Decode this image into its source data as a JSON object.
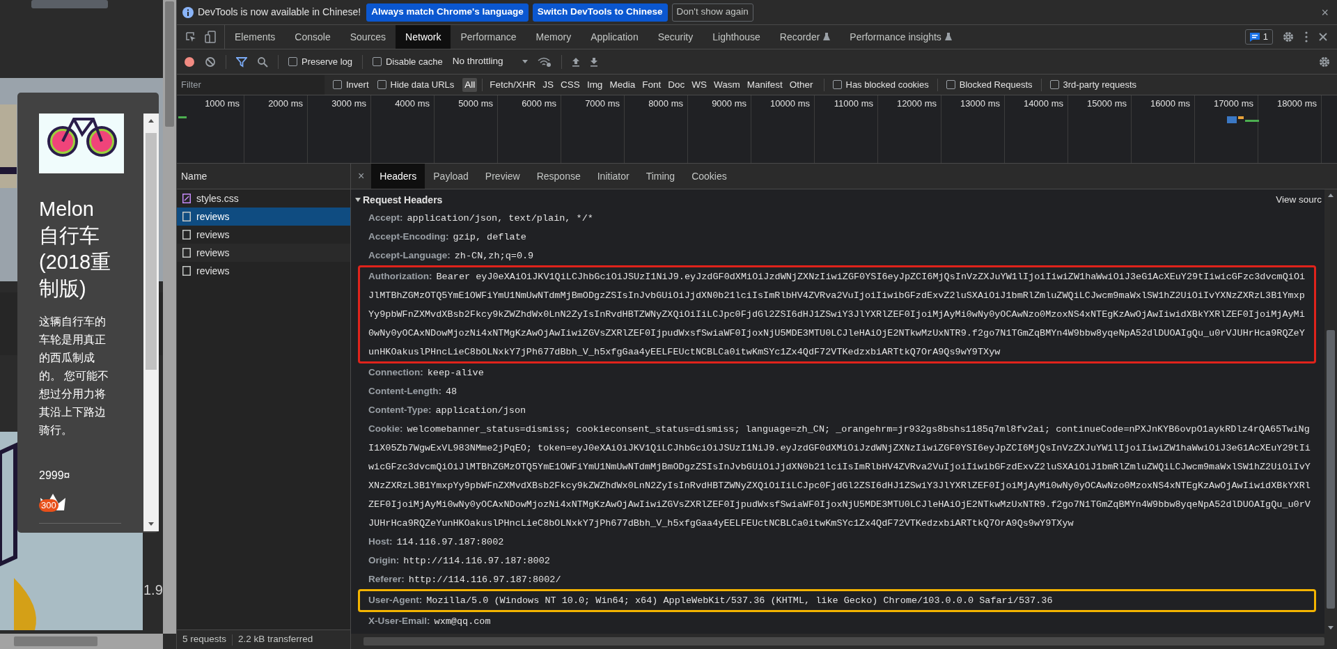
{
  "page": {
    "product_card": {
      "title": "Melon 自行车(2018重制版)",
      "description": "这辆自行车的车轮是用真正的西瓜制成的。 您可能不想过分用力将其沿上下路边骑行。",
      "price": "2999¤",
      "badge": "300"
    },
    "fragment": "1.9"
  },
  "devtools": {
    "infobar": {
      "message": "DevTools is now available in Chinese!",
      "buttons": [
        {
          "label": "Always match Chrome's language",
          "kind": "primary"
        },
        {
          "label": "Switch DevTools to Chinese",
          "kind": "primary"
        },
        {
          "label": "Don't show again",
          "kind": "secondary"
        }
      ],
      "close": "×"
    },
    "tabs": [
      {
        "label": "Elements",
        "selected": false,
        "kind": "plain"
      },
      {
        "label": "Console",
        "selected": false,
        "kind": "plain"
      },
      {
        "label": "Sources",
        "selected": false,
        "kind": "plain"
      },
      {
        "label": "Network",
        "selected": true,
        "kind": "plain"
      },
      {
        "label": "Performance",
        "selected": false,
        "kind": "plain"
      },
      {
        "label": "Memory",
        "selected": false,
        "kind": "plain"
      },
      {
        "label": "Application",
        "selected": false,
        "kind": "plain"
      },
      {
        "label": "Security",
        "selected": false,
        "kind": "plain"
      },
      {
        "label": "Lighthouse",
        "selected": false,
        "kind": "plain"
      },
      {
        "label": "Recorder",
        "selected": false,
        "kind": "experimental"
      },
      {
        "label": "Performance insights",
        "selected": false,
        "kind": "experimental"
      }
    ],
    "issues_count": "1",
    "toolbar": {
      "preserve_log": {
        "label": "Preserve log",
        "checked": false
      },
      "disable_cache": {
        "label": "Disable cache",
        "checked": false
      },
      "throttling": "No throttling"
    },
    "filter_bar": {
      "placeholder": "Filter",
      "invert": {
        "label": "Invert",
        "checked": false
      },
      "hide_data_urls": {
        "label": "Hide data URLs",
        "checked": false
      },
      "types": [
        {
          "label": "All",
          "selected": true
        },
        {
          "label": "Fetch/XHR",
          "selected": false
        },
        {
          "label": "JS",
          "selected": false
        },
        {
          "label": "CSS",
          "selected": false
        },
        {
          "label": "Img",
          "selected": false
        },
        {
          "label": "Media",
          "selected": false
        },
        {
          "label": "Font",
          "selected": false
        },
        {
          "label": "Doc",
          "selected": false
        },
        {
          "label": "WS",
          "selected": false
        },
        {
          "label": "Wasm",
          "selected": false
        },
        {
          "label": "Manifest",
          "selected": false
        },
        {
          "label": "Other",
          "selected": false
        }
      ],
      "options": [
        {
          "label": "Has blocked cookies",
          "checked": false
        },
        {
          "label": "Blocked Requests",
          "checked": false
        },
        {
          "label": "3rd-party requests",
          "checked": false
        }
      ]
    },
    "timeline": {
      "ticks": [
        "1000 ms",
        "2000 ms",
        "3000 ms",
        "4000 ms",
        "5000 ms",
        "6000 ms",
        "7000 ms",
        "8000 ms",
        "9000 ms",
        "10000 ms",
        "11000 ms",
        "12000 ms",
        "13000 ms",
        "14000 ms",
        "15000 ms",
        "16000 ms",
        "17000 ms",
        "18000 ms"
      ]
    },
    "requests": {
      "column": "Name",
      "rows": [
        {
          "name": "styles.css",
          "kind": "stylesheet",
          "selected": false
        },
        {
          "name": "reviews",
          "kind": "document",
          "selected": true
        },
        {
          "name": "reviews",
          "kind": "document",
          "selected": false
        },
        {
          "name": "reviews",
          "kind": "document",
          "selected": false
        },
        {
          "name": "reviews",
          "kind": "document",
          "selected": false
        }
      ]
    },
    "status": {
      "requests": "5 requests",
      "transferred": "2.2 kB transferred"
    },
    "details": {
      "close": "×",
      "tabs": [
        {
          "label": "Headers",
          "selected": true
        },
        {
          "label": "Payload",
          "selected": false
        },
        {
          "label": "Preview",
          "selected": false
        },
        {
          "label": "Response",
          "selected": false
        },
        {
          "label": "Initiator",
          "selected": false
        },
        {
          "label": "Timing",
          "selected": false
        },
        {
          "label": "Cookies",
          "selected": false
        }
      ],
      "section": {
        "title": "Request Headers",
        "expanded": true,
        "view_source": "View sourc",
        "headers": [
          {
            "name": "Accept:",
            "value": "application/json, text/plain, */*"
          },
          {
            "name": "Accept-Encoding:",
            "value": "gzip, deflate"
          },
          {
            "name": "Accept-Language:",
            "value": "zh-CN,zh;q=0.9"
          },
          {
            "name": "Authorization:",
            "value": "Bearer eyJ0eXAiOiJKV1QiLCJhbGciOiJSUzI1NiJ9.eyJzdGF0dXMiOiJzdWNjZXNzIiwiZGF0YSI6eyJpZCI6MjQsInVzZXJuYW1lIjoiIiwiZW1haWwiOiJ3eG1AcXEuY29tIiwicGFzc3dvcmQiOiJlMTBhZGMzOTQ5YmE1OWFiYmU1NmUwNTdmMjBmODgzZSIsInJvbGUiOiJjdXN0b21lciIsImRlbHV4ZVRva2VuIjoiIiwibGFzdExvZ2luSXAiOiJ1bmRlZmluZWQiLCJwcm9maWxlSW1hZ2UiOiIvYXNzZXRzL3B1YmxpYy9pbWFnZXMvdXBsb2Fkcy9kZWZhdWx0LnN2ZyIsInRvdHBTZWNyZXQiOiIiLCJpc0FjdGl2ZSI6dHJ1ZSwiY3JlYXRlZEF0IjoiMjAyMi0wNy0yOCAwNzo0MzoxNS4xNTEgKzAwOjAwIiwidXBkYXRlZEF0IjoiMjAyMi0wNy0yOCAxNDowMjozNi4xNTMgKzAwOjAwIiwiZGVsZXRlZEF0IjpudWxsfSwiaWF0IjoxNjU5MDE3MTU0LCJleHAiOjE2NTkwMzUxNTR9.f2go7N1TGmZqBMYn4W9bbw8yqeNpA52dlDUOAIgQu_u0rVJUHrHca9RQZeYunHKOakuslPHncLieC8bOLNxkY7jPh677dBbh_V_h5xfgGaa4yEELFEUctNCBLCa0itwKmSYc1Zx4QdF72VTKedzxbiARTtkQ7OrA9Qs9wY9TXyw",
            "color": "#e0231b"
          },
          {
            "name": "Connection:",
            "value": "keep-alive"
          },
          {
            "name": "Content-Length:",
            "value": "48"
          },
          {
            "name": "Content-Type:",
            "value": "application/json"
          },
          {
            "name": "Cookie:",
            "value": "welcomebanner_status=dismiss; cookieconsent_status=dismiss; language=zh_CN; _orangehrm=jr932gs8bshs1185q7ml8fv2ai; continueCode=nPXJnKYB6ovpO1aykRDlz4rQA65TwiNgI1X05Zb7WgwExVL983NMme2jPqEO; token=eyJ0eXAiOiJKV1QiLCJhbGciOiJSUzI1NiJ9.eyJzdGF0dXMiOiJzdWNjZXNzIiwiZGF0YSI6eyJpZCI6MjQsInVzZXJuYW1lIjoiIiwiZW1haWwiOiJ3eG1AcXEuY29tIiwicGFzc3dvcmQiOiJlMTBhZGMzOTQ5YmE1OWFiYmU1NmUwNTdmMjBmODgzZSIsInJvbGUiOiJjdXN0b21lciIsImRlbHV4ZVRva2VuIjoiIiwibGFzdExvZ2luSXAiOiJ1bmRlZmluZWQiLCJwcm9maWxlSW1hZ2UiOiIvYXNzZXRzL3B1YmxpYy9pbWFnZXMvdXBsb2Fkcy9kZWZhdWx0LnN2ZyIsInRvdHBTZWNyZXQiOiIiLCJpc0FjdGl2ZSI6dHJ1ZSwiY3JlYXRlZEF0IjoiMjAyMi0wNy0yOCAwNzo0MzoxNS4xNTEgKzAwOjAwIiwidXBkYXRlZEF0IjoiMjAyMi0wNy0yOCAxNDowMjozNi4xNTMgKzAwOjAwIiwiZGVsZXRlZEF0IjpudWxsfSwiaWF0IjoxNjU5MDE3MTU0LCJleHAiOjE2NTkwMzUxNTR9.f2go7N1TGmZqBMYn4W9bbw8yqeNpA52dlDUOAIgQu_u0rVJUHrHca9RQZeYunHKOakuslPHncLieC8bOLNxkY7jPh677dBbh_V_h5xfgGaa4yEELFEUctNCBLCa0itwKmSYc1Zx4QdF72VTKedzxbiARTtkQ7OrA9Qs9wY9TXyw"
          },
          {
            "name": "Host:",
            "value": "114.116.97.187:8002"
          },
          {
            "name": "Origin:",
            "value": "http://114.116.97.187:8002"
          },
          {
            "name": "Referer:",
            "value": "http://114.116.97.187:8002/"
          },
          {
            "name": "User-Agent:",
            "value": "Mozilla/5.0 (Windows NT 10.0; Win64; x64) AppleWebKit/537.36 (KHTML, like Gecko) Chrome/103.0.0.0 Safari/537.36",
            "color": "#f4b400"
          },
          {
            "name": "X-User-Email:",
            "value": "wxm@qq.com"
          }
        ]
      }
    }
  }
}
